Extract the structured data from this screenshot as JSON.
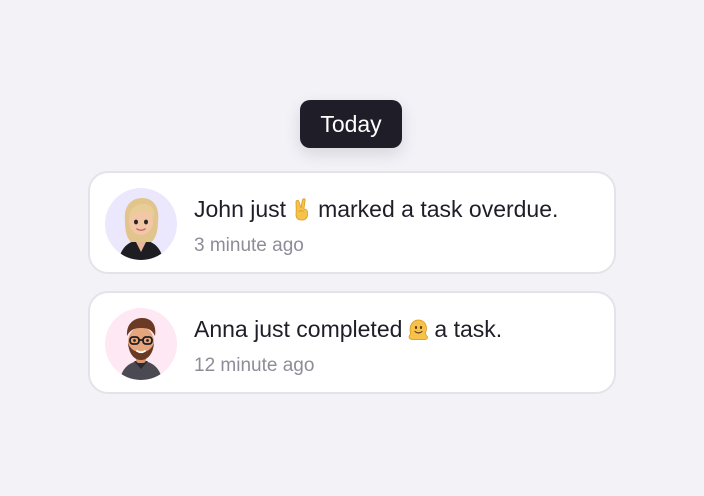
{
  "header": {
    "today_label": "Today"
  },
  "notifications": [
    {
      "name": "John",
      "text_before_emoji": "John just",
      "emoji_icon": "victory-hand-icon",
      "text_after_emoji": "marked a task overdue.",
      "time": "3 minute ago",
      "avatar_bg": "#ebe8fd"
    },
    {
      "name": "Anna",
      "text_before_emoji": "Anna just completed",
      "emoji_icon": "melting-face-icon",
      "text_after_emoji": "a task.",
      "time": "12 minute ago",
      "avatar_bg": "#fde8f3"
    }
  ],
  "colors": {
    "background": "#f3f2f7",
    "pill": "#1f1d28",
    "card_border": "#e4e3ea",
    "text_primary": "#1f1d28",
    "text_secondary": "#8e8c98"
  }
}
